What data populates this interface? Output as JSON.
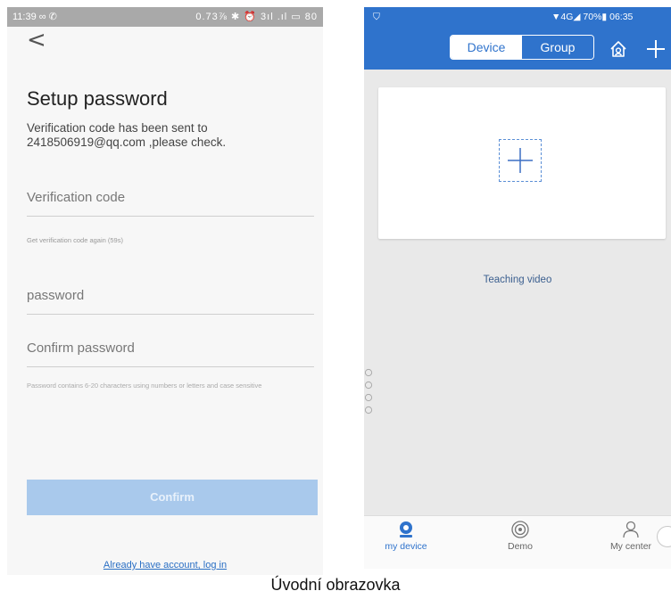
{
  "left_screen": {
    "status_bar": {
      "time": "11:39 ∞ ✆",
      "icons": "0.73⅞ ✱ ⏰ 3ıl .ıl ▭ 80"
    },
    "back_glyph": "<",
    "title": "Setup password",
    "sent_message": "Verification code has been sent to 2418506919@qq.com ,please check.",
    "verification_placeholder": "Verification code",
    "resend_text": "Get verification code again (59s)",
    "password_placeholder": "password",
    "confirm_password_placeholder": "Confirm password",
    "password_hint": "Password contains 6-20 characters using numbers or letters and case sensitive",
    "confirm_label": "Confirm",
    "login_link": "Already have account, log in"
  },
  "right_screen": {
    "status_bar": {
      "left_icon": "⛉",
      "right": "▼4G◢ 70%▮ 06:35"
    },
    "segment": {
      "device_label": "Device",
      "group_label": "Group",
      "active": "Device"
    },
    "teaching_video": "Teaching video",
    "tabs": [
      {
        "label": "my device",
        "icon": "camera-icon",
        "active": true
      },
      {
        "label": "Demo",
        "icon": "demo-icon",
        "active": false
      },
      {
        "label": "My center",
        "icon": "user-icon",
        "active": false
      }
    ],
    "colors": {
      "accent": "#2f73cc",
      "background": "#e9e9e9",
      "confirm_disabled": "#a9c9ec"
    }
  },
  "caption": "Úvodní obrazovka"
}
